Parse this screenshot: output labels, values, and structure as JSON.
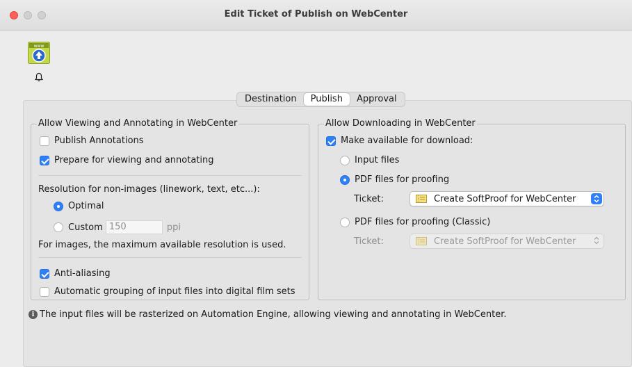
{
  "window": {
    "title": "Edit Ticket of Publish on WebCenter"
  },
  "tabs": [
    "Destination",
    "Publish",
    "Approval"
  ],
  "active_tab": "Publish",
  "left_group": {
    "title": "Allow Viewing and Annotating in WebCenter",
    "publish_annotations": {
      "label": "Publish Annotations",
      "checked": false
    },
    "prepare_viewing": {
      "label": "Prepare for viewing and annotating",
      "checked": true
    },
    "resolution_label": "Resolution for non-images (linework, text, etc...):",
    "optimal": {
      "label": "Optimal",
      "selected": true
    },
    "custom": {
      "label": "Custom",
      "selected": false,
      "value": "150",
      "unit": "ppi"
    },
    "images_note": "For images, the maximum available resolution is used.",
    "anti_aliasing": {
      "label": "Anti-aliasing",
      "checked": true
    },
    "auto_grouping": {
      "label": "Automatic grouping of input files into digital film sets",
      "checked": false
    }
  },
  "right_group": {
    "title": "Allow Downloading in WebCenter",
    "make_available": {
      "label": "Make available for download:",
      "checked": true
    },
    "input_files": {
      "label": "Input files",
      "selected": false
    },
    "pdf_proofing": {
      "label": "PDF files for proofing",
      "selected": true
    },
    "ticket_label_1": "Ticket:",
    "ticket_value_1": "Create SoftProof for WebCenter",
    "pdf_proofing_classic": {
      "label": "PDF files for proofing (Classic)",
      "selected": false
    },
    "ticket_label_2": "Ticket:",
    "ticket_value_2": "Create SoftProof for WebCenter"
  },
  "info_text": "The input files will be rasterized on Automation Engine, allowing viewing and annotating in WebCenter.",
  "icons": [
    "publish-webcenter-icon",
    "bell-icon",
    "info-icon",
    "ticket-icon"
  ],
  "colors": {
    "accent": "#2f7ff6",
    "close": "#fe5f57"
  }
}
